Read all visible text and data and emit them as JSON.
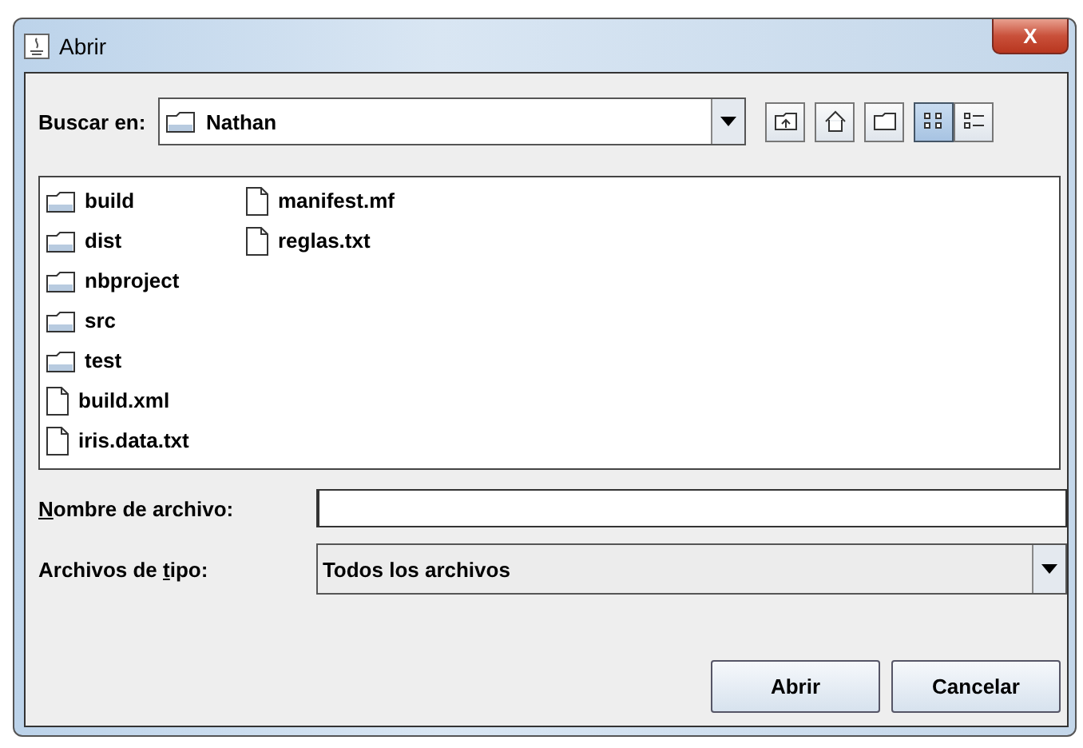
{
  "window": {
    "title": "Abrir",
    "close_glyph": "X"
  },
  "look_in": {
    "label": "Buscar en:",
    "value": "Nathan"
  },
  "files": [
    {
      "name": "build",
      "kind": "folder"
    },
    {
      "name": "dist",
      "kind": "folder"
    },
    {
      "name": "nbproject",
      "kind": "folder"
    },
    {
      "name": "src",
      "kind": "folder"
    },
    {
      "name": "test",
      "kind": "folder"
    },
    {
      "name": "build.xml",
      "kind": "file"
    },
    {
      "name": "iris.data.txt",
      "kind": "file"
    },
    {
      "name": "manifest.mf",
      "kind": "file"
    },
    {
      "name": "reglas.txt",
      "kind": "file"
    }
  ],
  "view_buttons": [
    {
      "kind": "up",
      "selected": false
    },
    {
      "kind": "home",
      "selected": false
    },
    {
      "kind": "new-folder",
      "selected": false
    },
    {
      "kind": "list",
      "selected": true
    },
    {
      "kind": "details",
      "selected": false
    }
  ],
  "file_name": {
    "label": {
      "key": "N",
      "after": "ombre de archivo:"
    }
  },
  "file_type": {
    "label": {
      "before": "Archivos de ",
      "key": "t",
      "after": "ipo:"
    },
    "value": "Todos los archivos"
  },
  "buttons": [
    "Abrir",
    "Cancelar"
  ]
}
